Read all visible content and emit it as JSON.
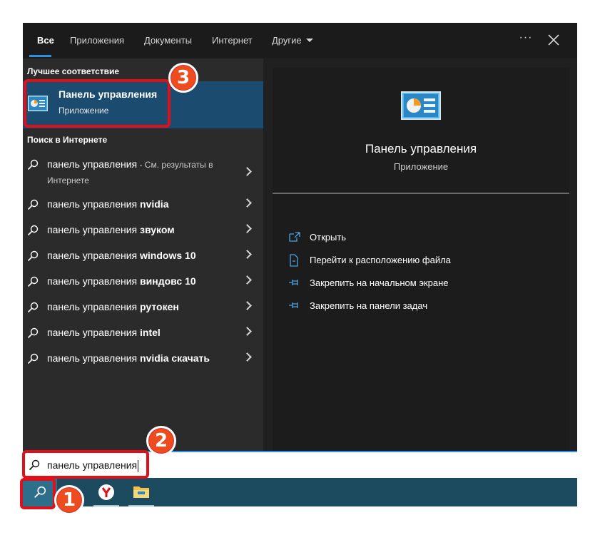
{
  "tabs": [
    {
      "label": "Все",
      "active": true
    },
    {
      "label": "Приложения"
    },
    {
      "label": "Документы"
    },
    {
      "label": "Интернет"
    },
    {
      "label": "Другие"
    }
  ],
  "window_controls": {
    "more_label": "···",
    "close_icon": "close-icon"
  },
  "left": {
    "best_match_heading": "Лучшее соответствие",
    "best_match": {
      "title": "Панель управления",
      "subtitle": "Приложение",
      "icon": "control-panel-icon"
    },
    "web_heading": "Поиск в Интернете",
    "web_rows": [
      {
        "prefix": "панель управления",
        "bold": "",
        "hint": " - См. результаты в Интернете"
      },
      {
        "prefix": "панель управления ",
        "bold": "nvidia"
      },
      {
        "prefix": "панель управления ",
        "bold": "звуком"
      },
      {
        "prefix": "панель управления ",
        "bold": "windows 10"
      },
      {
        "prefix": "панель управления ",
        "bold": "виндовс 10"
      },
      {
        "prefix": "панель управления ",
        "bold": "рутокен"
      },
      {
        "prefix": "панель управления ",
        "bold": "intel"
      },
      {
        "prefix": "панель управления ",
        "bold": "nvidia скачать"
      }
    ]
  },
  "right": {
    "title": "Панель управления",
    "subtitle": "Приложение",
    "actions": [
      {
        "label": "Открыть",
        "icon": "open-icon"
      },
      {
        "label": "Перейти к расположению файла",
        "icon": "file-location-icon"
      },
      {
        "label": "Закрепить на начальном экране",
        "icon": "pin-icon"
      },
      {
        "label": "Закрепить на панели задач",
        "icon": "pin-icon"
      }
    ]
  },
  "search": {
    "value": "панель управления"
  },
  "taskbar": {
    "items": [
      "search-icon",
      "yandex-browser-icon",
      "file-explorer-icon"
    ]
  },
  "callouts": [
    {
      "number": "1",
      "target": "taskbar search button"
    },
    {
      "number": "2",
      "target": "search input"
    },
    {
      "number": "3",
      "target": "best match result"
    }
  ],
  "colors": {
    "accent": "#2f8fe0",
    "selection": "#1b4b6f",
    "callout": "#e0101b",
    "badge": "#ee4b1f",
    "taskbar": "#1c4a5f"
  }
}
